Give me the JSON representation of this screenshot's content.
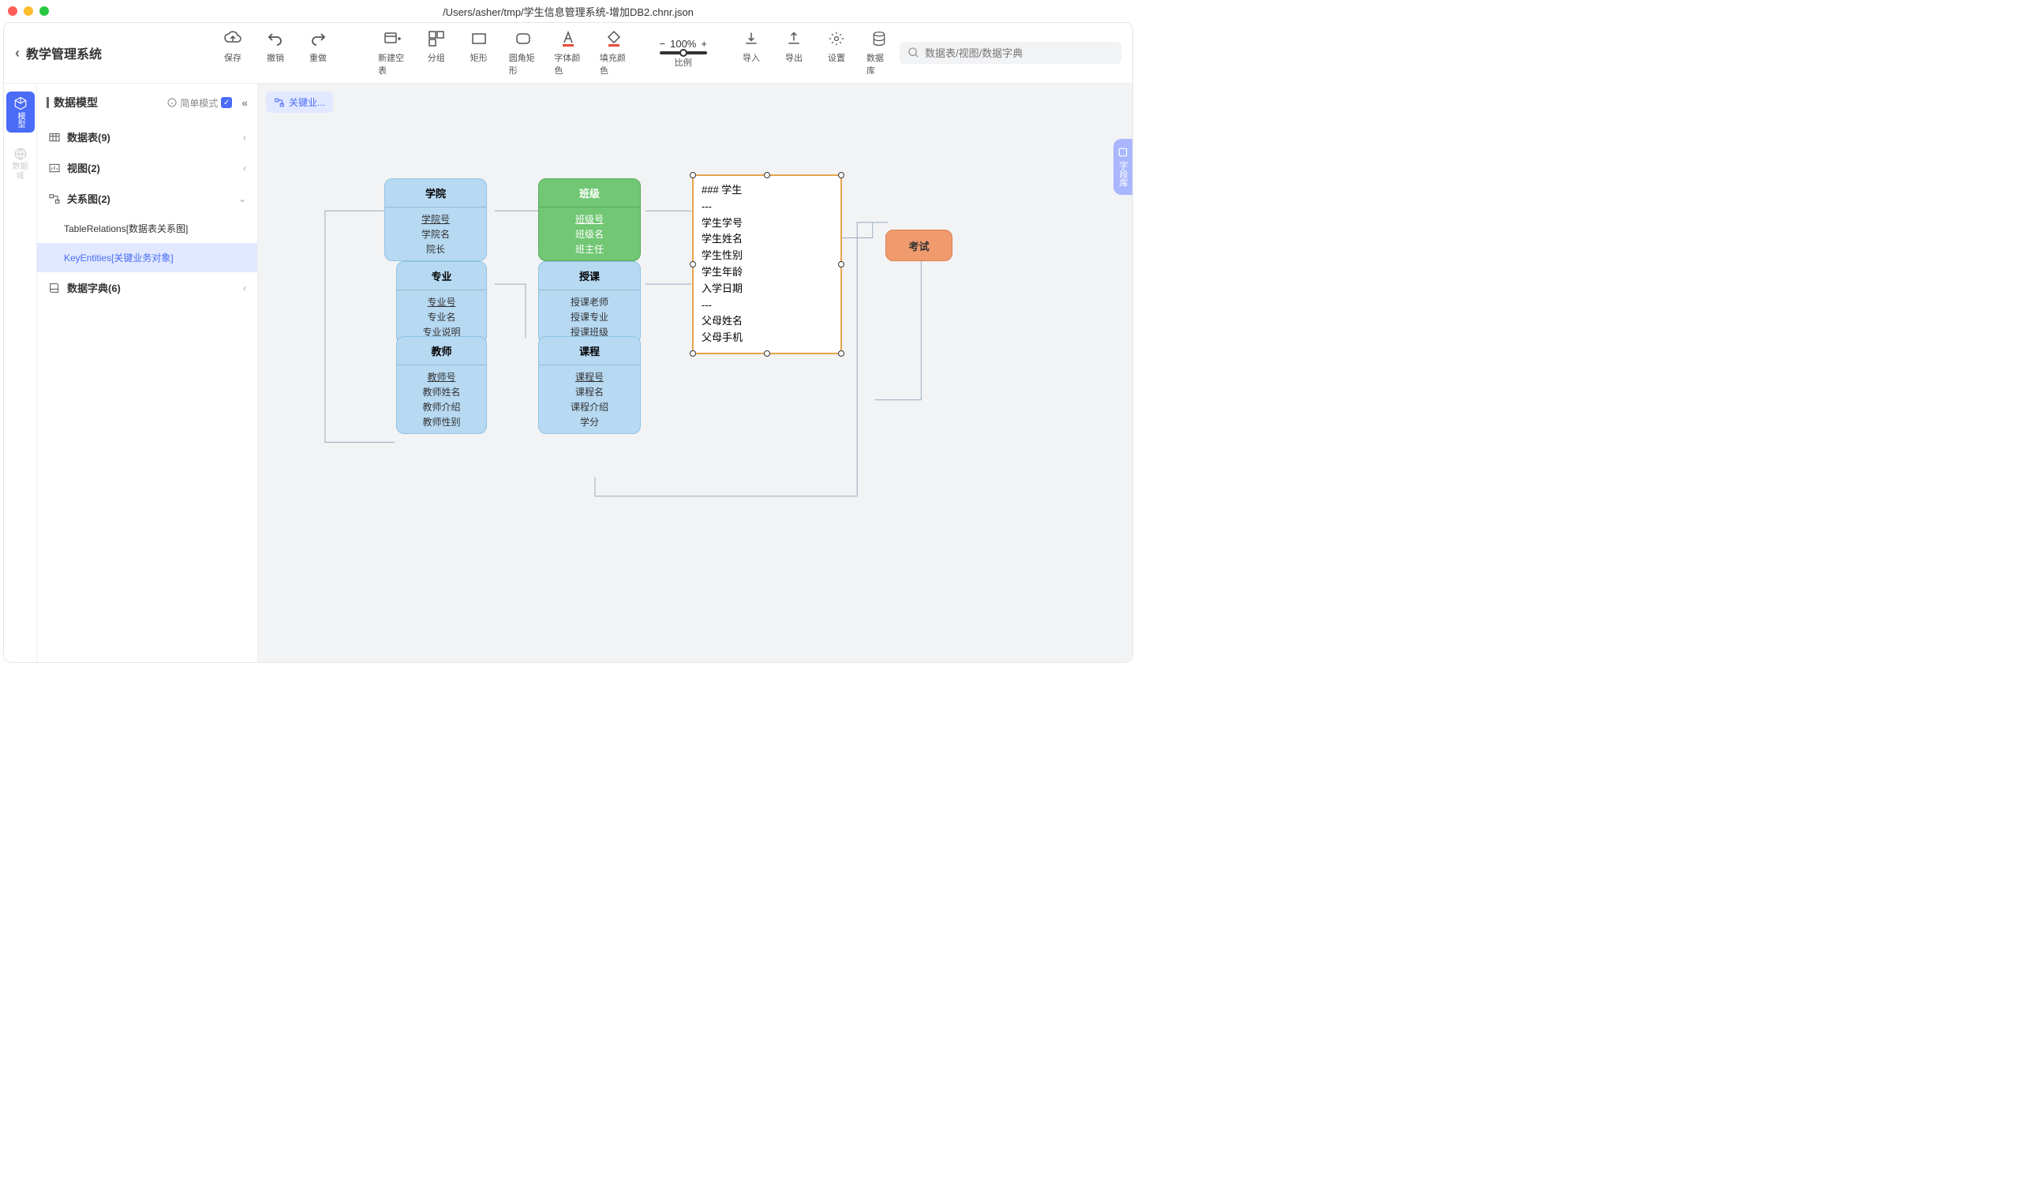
{
  "window_title": "/Users/asher/tmp/学生信息管理系统-增加DB2.chnr.json",
  "header": {
    "back_title": "教学管理系统"
  },
  "toolbar": {
    "save": "保存",
    "undo": "撤销",
    "redo": "重做",
    "new_table": "新建空表",
    "group": "分组",
    "rect": "矩形",
    "round_rect": "圆角矩形",
    "font_color": "字体颜色",
    "fill_color": "填充颜色",
    "zoom_value": "100%",
    "zoom_label": "比例",
    "import": "导入",
    "export": "导出",
    "settings": "设置",
    "database": "数据库"
  },
  "search": {
    "placeholder": "数据表/视图/数据字典"
  },
  "rail": {
    "model": "模型",
    "domain": "数据域"
  },
  "sidebar": {
    "title": "数据模型",
    "mode": "简单模式",
    "items": {
      "tables": "数据表(9)",
      "views": "视图(2)",
      "er": "关系图(2)",
      "er_sub1": "TableRelations[数据表关系图]",
      "er_sub2": "KeyEntities[关键业务对象]",
      "dict": "数据字典(6)"
    }
  },
  "tab": "关键业...",
  "field_lib": "字段库",
  "entities": {
    "college": {
      "title": "学院",
      "f1": "学院号",
      "f2": "学院名",
      "f3": "院长"
    },
    "class": {
      "title": "班级",
      "f1": "班级号",
      "f2": "班级名",
      "f3": "班主任"
    },
    "major": {
      "title": "专业",
      "f1": "专业号",
      "f2": "专业名",
      "f3": "专业说明"
    },
    "teach": {
      "title": "授课",
      "f1": "授课老师",
      "f2": "授课专业",
      "f3": "授课班级"
    },
    "teacher": {
      "title": "教师",
      "f1": "教师号",
      "f2": "教师姓名",
      "f3": "教师介绍",
      "f4": "教师性别"
    },
    "course": {
      "title": "课程",
      "f1": "课程号",
      "f2": "课程名",
      "f3": "课程介绍",
      "f4": "学分"
    },
    "exam": {
      "title": "考试"
    }
  },
  "student_note": {
    "l1": "### 学生",
    "l2": "---",
    "l3": "学生学号",
    "l4": "学生姓名",
    "l5": "学生性别",
    "l6": "学生年龄",
    "l7": "入学日期",
    "l8": "---",
    "l9": "父母姓名",
    "l10": "父母手机"
  }
}
